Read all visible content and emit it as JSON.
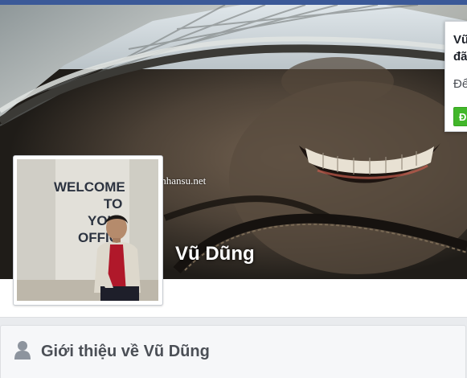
{
  "cover": {
    "watermark": "Blognhansu.net"
  },
  "profile": {
    "name": "Vũ Dũng",
    "avatar_sign": {
      "line1": "WELCOME",
      "line2": "TO",
      "line3": "YOU",
      "line4": "OFFIC"
    }
  },
  "friend_popup": {
    "title_line1": "Vũ",
    "title_line2": "đã",
    "body_text": "Để",
    "button_label": "Đ"
  },
  "about": {
    "title": "Giới thiệu về Vũ Dũng",
    "icon": "person-icon"
  },
  "colors": {
    "nav": "#3b5998",
    "button": "#42b72a",
    "page_background": "#e9ebee"
  }
}
